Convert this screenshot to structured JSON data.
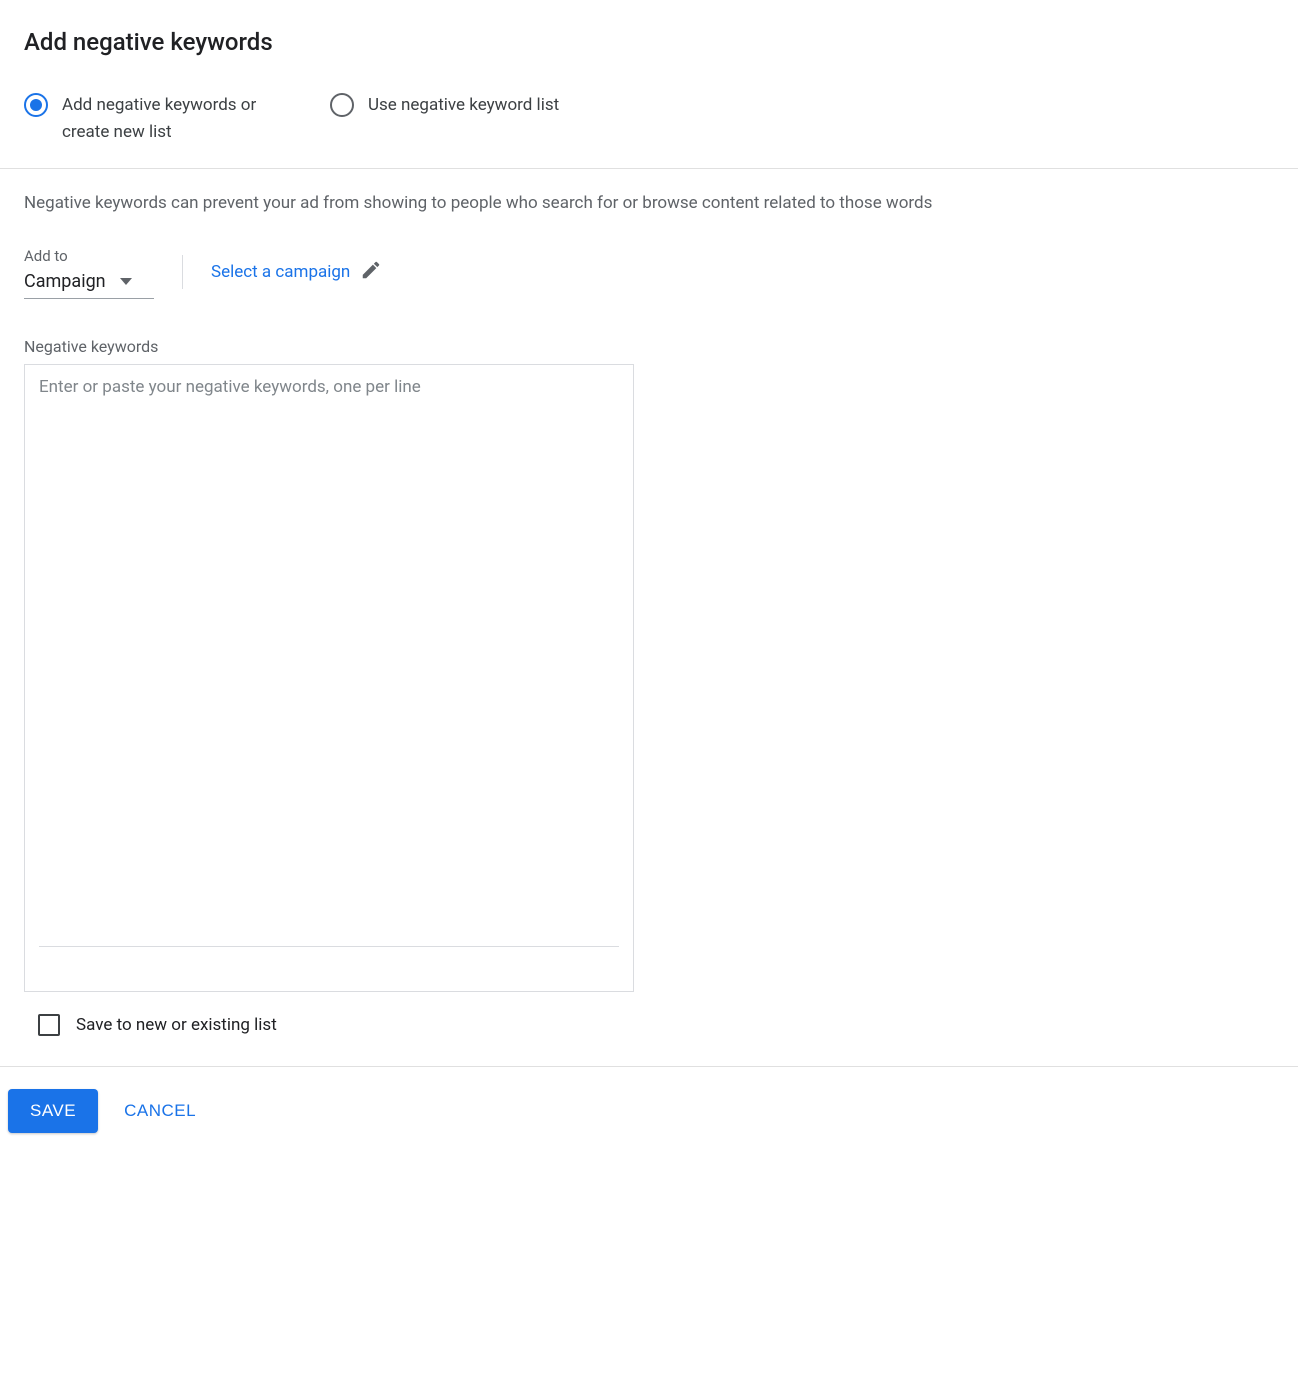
{
  "title": "Add negative keywords",
  "radios": {
    "option1": {
      "label": "Add negative keywords or create new list",
      "selected": true
    },
    "option2": {
      "label": "Use negative keyword list",
      "selected": false
    }
  },
  "description": "Negative keywords can prevent your ad from showing to people who search for or browse content related to those words",
  "addto": {
    "label": "Add to",
    "value": "Campaign",
    "select_link": "Select a campaign"
  },
  "keywords_field": {
    "label": "Negative keywords",
    "placeholder": "Enter or paste your negative keywords, one per line",
    "value": ""
  },
  "save_list": {
    "label": "Save to new or existing list",
    "checked": false
  },
  "buttons": {
    "save": "SAVE",
    "cancel": "CANCEL"
  }
}
